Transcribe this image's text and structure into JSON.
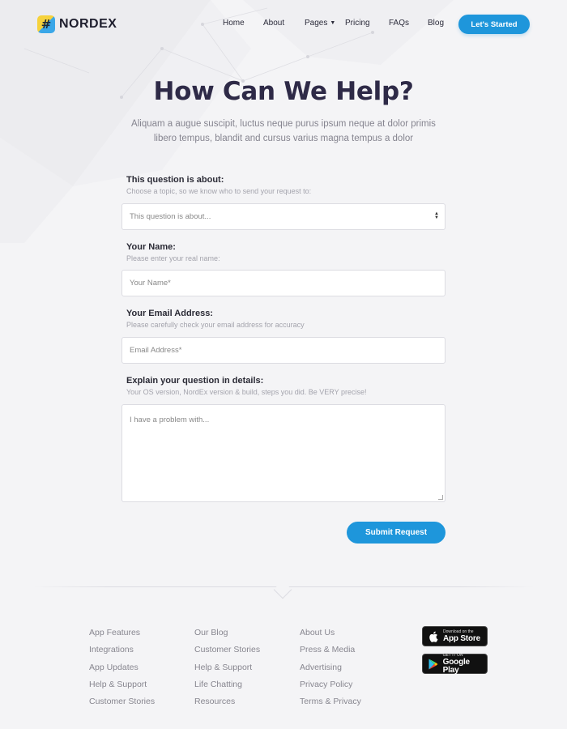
{
  "brand": {
    "name": "NORDEX",
    "mark": "#"
  },
  "nav": {
    "items": [
      "Home",
      "About",
      "Pages",
      "Pricing",
      "FAQs",
      "Blog"
    ],
    "cta": "Let's Started"
  },
  "hero": {
    "title": "How Can We Help?",
    "subtitle_line1": "Aliquam a augue suscipit, luctus neque purus ipsum neque at dolor primis",
    "subtitle_line2": "libero tempus, blandit and cursus varius magna tempus a dolor"
  },
  "form": {
    "topic": {
      "label": "This question is about:",
      "help": "Choose a topic, so we know who to send your request to:",
      "value": "This question is about..."
    },
    "name": {
      "label": "Your Name:",
      "help": "Please enter your real name:",
      "placeholder": "Your Name*"
    },
    "email": {
      "label": "Your Email Address:",
      "help": "Please carefully check your email address for accuracy",
      "placeholder": "Email Address*"
    },
    "details": {
      "label": "Explain your question in details:",
      "help": "Your OS version, NordEx version & build, steps you did. Be VERY precise!",
      "placeholder": "I have a problem with..."
    },
    "submit": "Submit Request"
  },
  "footer": {
    "col1": [
      "App Features",
      "Integrations",
      "App Updates",
      "Help & Support",
      "Customer Stories"
    ],
    "col2": [
      "Our Blog",
      "Customer Stories",
      "Help & Support",
      "Life Chatting",
      "Resources"
    ],
    "col3": [
      "About Us",
      "Press & Media",
      "Advertising",
      "Privacy Policy",
      "Terms & Privacy"
    ],
    "app_store": {
      "small": "Download on the",
      "big": "App Store"
    },
    "google_play": {
      "small": "GET IT ON",
      "big": "Google Play"
    }
  },
  "colors": {
    "accent": "#1e96db",
    "title": "#2e2a47",
    "background": "#f4f4f6"
  }
}
